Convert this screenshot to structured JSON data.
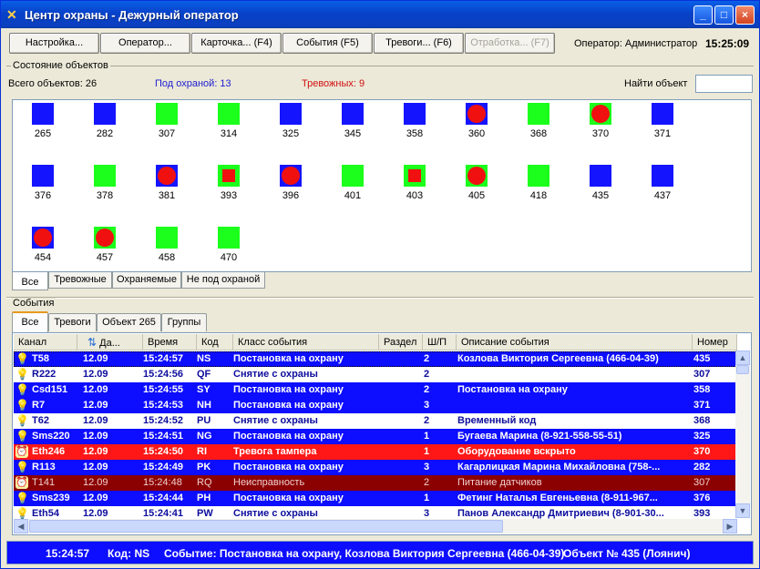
{
  "window": {
    "title": "Центр охраны - Дежурный оператор",
    "controls": [
      "_",
      "□",
      "×"
    ]
  },
  "toolbar": {
    "buttons": [
      {
        "label": "Настройка...",
        "enabled": true
      },
      {
        "label": "Оператор...",
        "enabled": true
      },
      {
        "label": "Карточка... (F4)",
        "enabled": true
      },
      {
        "label": "События (F5)",
        "enabled": true
      },
      {
        "label": "Тревоги... (F6)",
        "enabled": true
      },
      {
        "label": "Отработка... (F7)",
        "enabled": false
      }
    ],
    "operator": "Оператор: Администратор",
    "time": "15:25:09"
  },
  "objects_section": {
    "title": "Состояние объектов",
    "total": "Всего объектов: 26",
    "guarded": "Под охраной: 13",
    "alarms": "Тревожных: 9",
    "find_label": "Найти объект",
    "find_value": "",
    "colors": {
      "guarded": "#1414ff",
      "unguarded": "#1cff1c",
      "alarm": "#f01010"
    },
    "objects": [
      {
        "id": "265",
        "color": "blue",
        "alarm": "none"
      },
      {
        "id": "282",
        "color": "blue",
        "alarm": "none"
      },
      {
        "id": "307",
        "color": "green",
        "alarm": "none"
      },
      {
        "id": "314",
        "color": "green",
        "alarm": "none"
      },
      {
        "id": "325",
        "color": "blue",
        "alarm": "none"
      },
      {
        "id": "345",
        "color": "blue",
        "alarm": "none"
      },
      {
        "id": "358",
        "color": "blue",
        "alarm": "none"
      },
      {
        "id": "360",
        "color": "blue",
        "alarm": "circle"
      },
      {
        "id": "368",
        "color": "green",
        "alarm": "none"
      },
      {
        "id": "370",
        "color": "green",
        "alarm": "circle"
      },
      {
        "id": "371",
        "color": "blue",
        "alarm": "none"
      },
      {
        "id": "376",
        "color": "blue",
        "alarm": "none"
      },
      {
        "id": "378",
        "color": "green",
        "alarm": "none"
      },
      {
        "id": "381",
        "color": "blue",
        "alarm": "circle"
      },
      {
        "id": "393",
        "color": "green",
        "alarm": "square"
      },
      {
        "id": "396",
        "color": "blue",
        "alarm": "circle"
      },
      {
        "id": "401",
        "color": "green",
        "alarm": "none"
      },
      {
        "id": "403",
        "color": "green",
        "alarm": "square"
      },
      {
        "id": "405",
        "color": "green",
        "alarm": "circle"
      },
      {
        "id": "418",
        "color": "green",
        "alarm": "none"
      },
      {
        "id": "435",
        "color": "blue",
        "alarm": "none"
      },
      {
        "id": "437",
        "color": "blue",
        "alarm": "none"
      },
      {
        "id": "454",
        "color": "blue",
        "alarm": "circle"
      },
      {
        "id": "457",
        "color": "green",
        "alarm": "circle"
      },
      {
        "id": "458",
        "color": "green",
        "alarm": "none"
      },
      {
        "id": "470",
        "color": "green",
        "alarm": "none"
      }
    ],
    "tabs": [
      "Все",
      "Тревожные",
      "Охраняемые",
      "Не под охраной"
    ],
    "active_tab": "Все"
  },
  "events_section": {
    "title": "События",
    "tabs": [
      "Все",
      "Тревоги",
      "Объект 265",
      "Группы"
    ],
    "active_tab": "Все",
    "columns": [
      "Канал",
      "Да...",
      "Время",
      "Код",
      "Класс события",
      "Раздел",
      "Ш/П",
      "Описание события",
      "Номер"
    ],
    "rows": [
      {
        "icon": "lamp",
        "style": "blue",
        "selected": true,
        "channel": "T58",
        "date": "12.09",
        "time": "15:24:57",
        "code": "NS",
        "class": "Постановка на охрану",
        "section": "",
        "zone": "2",
        "description": "Козлова Виктория Сергеевна (466-04-39)",
        "number": "435"
      },
      {
        "icon": "lamp",
        "style": "white",
        "selected": false,
        "channel": "R222",
        "date": "12.09",
        "time": "15:24:56",
        "code": "QF",
        "class": "Снятие с охраны",
        "section": "",
        "zone": "2",
        "description": "",
        "number": "307"
      },
      {
        "icon": "lamp",
        "style": "blue",
        "selected": false,
        "channel": "Csd151",
        "date": "12.09",
        "time": "15:24:55",
        "code": "SY",
        "class": "Постановка на охрану",
        "section": "",
        "zone": "2",
        "description": "Постановка на охрану",
        "number": "358"
      },
      {
        "icon": "lamp",
        "style": "blue",
        "selected": false,
        "channel": "R7",
        "date": "12.09",
        "time": "15:24:53",
        "code": "NH",
        "class": "Постановка на охрану",
        "section": "",
        "zone": "3",
        "description": "",
        "number": "371"
      },
      {
        "icon": "lamp",
        "style": "white",
        "selected": false,
        "channel": "T62",
        "date": "12.09",
        "time": "15:24:52",
        "code": "PU",
        "class": "Снятие с охраны",
        "section": "",
        "zone": "2",
        "description": "Временный код",
        "number": "368"
      },
      {
        "icon": "lamp",
        "style": "blue",
        "selected": false,
        "channel": "Sms220",
        "date": "12.09",
        "time": "15:24:51",
        "code": "NG",
        "class": "Постановка на охрану",
        "section": "",
        "zone": "1",
        "description": "Бугаева Марина  (8-921-558-55-51)",
        "number": "325"
      },
      {
        "icon": "alarm",
        "style": "red",
        "selected": false,
        "channel": "Eth246",
        "date": "12.09",
        "time": "15:24:50",
        "code": "RI",
        "class": "Тревога тампера",
        "section": "",
        "zone": "1",
        "description": "Оборудование вскрыто",
        "number": "370"
      },
      {
        "icon": "lamp",
        "style": "blue",
        "selected": false,
        "channel": "R113",
        "date": "12.09",
        "time": "15:24:49",
        "code": "PK",
        "class": "Постановка на охрану",
        "section": "",
        "zone": "3",
        "description": "Кагарлицкая Марина Михайловна (758-...",
        "number": "282"
      },
      {
        "icon": "alarm",
        "style": "maroon",
        "selected": false,
        "channel": "T141",
        "date": "12.09",
        "time": "15:24:48",
        "code": "RQ",
        "class": "Неисправность",
        "section": "",
        "zone": "2",
        "description": "Питание датчиков",
        "number": "307"
      },
      {
        "icon": "lamp",
        "style": "blue",
        "selected": false,
        "channel": "Sms239",
        "date": "12.09",
        "time": "15:24:44",
        "code": "PH",
        "class": "Постановка на охрану",
        "section": "",
        "zone": "1",
        "description": "Фетинг Наталья Евгеньевна (8-911-967...",
        "number": "376"
      },
      {
        "icon": "lamp",
        "style": "white",
        "selected": false,
        "channel": "Eth54",
        "date": "12.09",
        "time": "15:24:41",
        "code": "PW",
        "class": "Снятие с охраны",
        "section": "",
        "zone": "3",
        "description": "Панов Александр Дмитриевич (8-901-30...",
        "number": "393"
      }
    ]
  },
  "statusbar": {
    "time": "15:24:57",
    "code": "Код: NS",
    "event": "Событие: Постановка на охрану, Козлова Виктория Сергеевна (466-04-39)",
    "object": "Объект № 435 (Лоянич)"
  }
}
